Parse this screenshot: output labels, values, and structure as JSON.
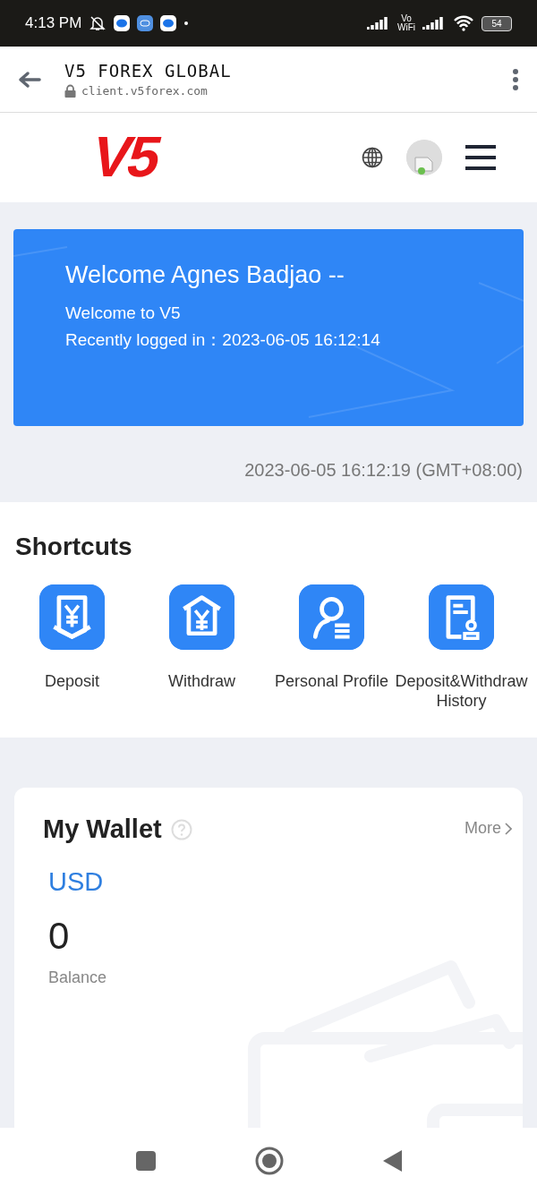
{
  "status_bar": {
    "time": "4:13 PM",
    "network_top": "Vo",
    "network_bottom": "WiFi",
    "battery": "54"
  },
  "browser": {
    "title": "V5 FOREX GLOBAL",
    "url": "client.v5forex.com"
  },
  "header": {
    "logo_text": "V5"
  },
  "welcome": {
    "title": "Welcome Agnes Badjao --",
    "subtitle": "Welcome to V5",
    "last_login": "Recently logged in：2023-06-05 16:12:14"
  },
  "server_time": "2023-06-05 16:12:19 (GMT+08:00)",
  "shortcuts": {
    "title": "Shortcuts",
    "items": [
      {
        "kind": "deposit",
        "label": "Deposit"
      },
      {
        "kind": "withdraw",
        "label": "Withdraw"
      },
      {
        "kind": "profile",
        "label": "Personal Profile"
      },
      {
        "kind": "history",
        "label": "Deposit&Withdraw History"
      }
    ]
  },
  "wallet": {
    "title": "My Wallet",
    "more": "More",
    "currency": "USD",
    "amount": "0",
    "amount_label": "Balance"
  }
}
